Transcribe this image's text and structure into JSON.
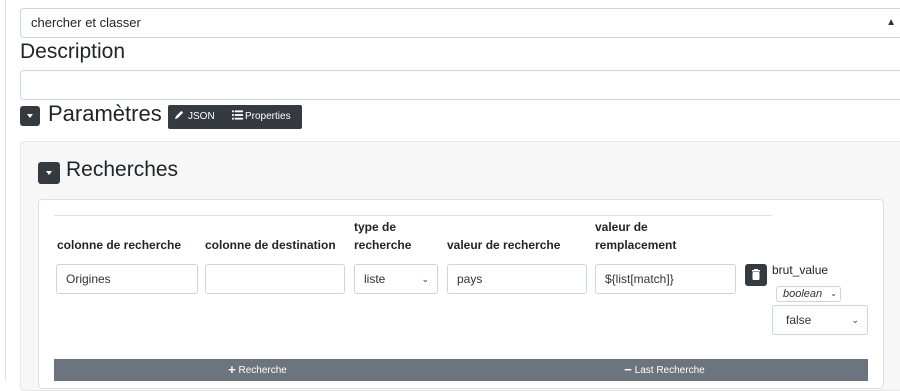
{
  "top_select": {
    "value": "chercher et classer"
  },
  "description": {
    "title": "Description",
    "value": ""
  },
  "parametres": {
    "title": "Paramètres",
    "json_button": "JSON",
    "properties_button": "Properties"
  },
  "recherches": {
    "title": "Recherches",
    "columns": [
      [
        "colonne de recherche"
      ],
      [
        "colonne de destination"
      ],
      [
        "type de",
        "recherche"
      ],
      [
        "valeur de recherche"
      ],
      [
        "valeur de",
        "remplacement"
      ]
    ],
    "row": {
      "colonne_recherche": "Origines",
      "colonne_destination": "",
      "type_recherche": "liste",
      "valeur_recherche": "pays",
      "valeur_remplacement": "${list[match]}",
      "brut_value_label": "brut_value",
      "brut_type": "boolean",
      "brut_value": "false"
    },
    "add_button": "Recherche",
    "remove_button": "Last Recherche"
  },
  "colors": {
    "dark": "#343a40",
    "bar": "#6c757d"
  }
}
